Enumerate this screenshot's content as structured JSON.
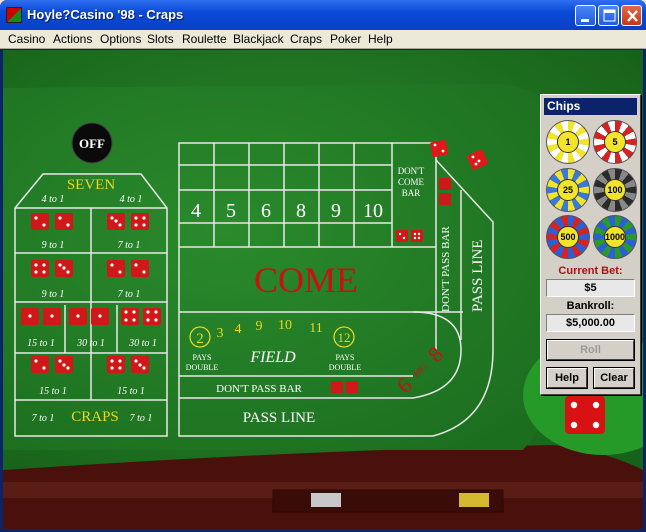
{
  "window": {
    "title": "Hoyle?Casino '98 - Craps"
  },
  "menu": [
    "Casino",
    "Actions",
    "Options",
    "Slots",
    "Roulette",
    "Blackjack",
    "Craps",
    "Poker",
    "Help"
  ],
  "table": {
    "off_puck": "OFF",
    "seven": "SEVEN",
    "prop_odds": [
      "4 to 1",
      "4 to 1",
      "9 to 1",
      "7 to 1",
      "9 to 1",
      "7 to 1",
      "15 to 1",
      "30 to 1",
      "30 to 1",
      "15 to 1",
      "15 to 1",
      "7 to 1",
      "7 to 1"
    ],
    "craps": "CRAPS",
    "place_numbers": [
      "4",
      "5",
      "6",
      "8",
      "9",
      "10"
    ],
    "dont_come_bar": [
      "DON'T",
      "COME",
      "BAR"
    ],
    "come": "COME",
    "field_numbers": [
      "3",
      "4",
      "9",
      "10",
      "11"
    ],
    "field_two": "2",
    "field_twelve": "12",
    "pays": "PAYS",
    "double": "DOUBLE",
    "field": "FIELD",
    "dont_pass_bar": "DON'T PASS BAR",
    "dont_pass_bar_vertical": "DON'T PASS BAR",
    "pass_line": "PASS LINE",
    "pass_line_vertical": "PASS LINE",
    "big_six": "6",
    "big_word": "BIG",
    "big_eight": "8"
  },
  "chips_panel": {
    "title": "Chips",
    "chips": [
      {
        "label": "1",
        "color": "#f2e42a"
      },
      {
        "label": "5",
        "color": "#d62222"
      },
      {
        "label": "25",
        "color": "#f2e42a"
      },
      {
        "label": "100",
        "color": "#2a2a2a"
      },
      {
        "label": "500",
        "color": "#2a5fd6"
      },
      {
        "label": "1000",
        "color": "#2a9a2a"
      }
    ],
    "current_bet_label": "Current Bet:",
    "current_bet": "$5",
    "bankroll_label": "Bankroll:",
    "bankroll": "$5,000.00",
    "roll_label": "Roll",
    "help_label": "Help",
    "clear_label": "Clear"
  },
  "colors": {
    "felt": "#1f7a22",
    "rail": "#6b1a14",
    "table_red": "#cc1010",
    "yellow_text": "#e8d820"
  }
}
